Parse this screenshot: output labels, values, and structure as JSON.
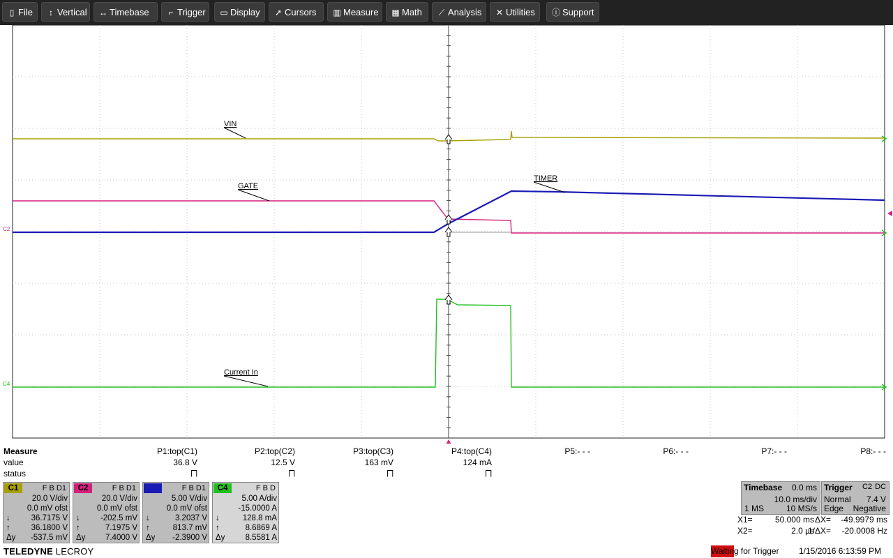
{
  "menu": [
    {
      "label": "File",
      "icon": "file-icon",
      "glyph": "▯"
    },
    {
      "label": "Vertical",
      "icon": "vertical-arrows-icon",
      "glyph": "↕"
    },
    {
      "label": "Timebase",
      "icon": "horizontal-arrows-icon",
      "glyph": "↔"
    },
    {
      "label": "Trigger",
      "icon": "trigger-icon",
      "glyph": "⌐"
    },
    {
      "label": "Display",
      "icon": "display-icon",
      "glyph": "▭"
    },
    {
      "label": "Cursors",
      "icon": "cursor-icon",
      "glyph": "➚"
    },
    {
      "label": "Measure",
      "icon": "measure-icon",
      "glyph": "▥"
    },
    {
      "label": "Math",
      "icon": "calculator-icon",
      "glyph": "▦"
    },
    {
      "label": "Analysis",
      "icon": "analysis-chart-icon",
      "glyph": "⟋"
    },
    {
      "label": "Utilities",
      "icon": "tools-icon",
      "glyph": "✕"
    },
    {
      "label": "Support",
      "icon": "info-icon",
      "glyph": "ⓘ"
    }
  ],
  "traces": {
    "vin": {
      "label": "VIN",
      "color": "#a8a000"
    },
    "gate": {
      "label": "GATE",
      "color": "#d4207c"
    },
    "timer": {
      "label": "TIMER",
      "color": "#1a1ab4"
    },
    "current": {
      "label": "Current In",
      "color": "#22c022"
    }
  },
  "markers": {
    "c2": "C2",
    "c4": "C4"
  },
  "measure": {
    "title": "Measure",
    "row_labels": [
      "value",
      "status"
    ],
    "params": [
      {
        "name": "P1:top(C1)",
        "value": "36.8 V",
        "status": "⨅"
      },
      {
        "name": "P2:top(C2)",
        "value": "12.5 V",
        "status": "⨅"
      },
      {
        "name": "P3:top(C3)",
        "value": "163 mV",
        "status": "⨅"
      },
      {
        "name": "P4:top(C4)",
        "value": "124 mA",
        "status": "⨅"
      },
      {
        "name": "P5:- - -",
        "value": "",
        "status": ""
      },
      {
        "name": "P6:- - -",
        "value": "",
        "status": ""
      },
      {
        "name": "P7:- - -",
        "value": "",
        "status": ""
      },
      {
        "name": "P8:- - -",
        "value": "",
        "status": ""
      }
    ]
  },
  "channels": [
    {
      "tag": "C1",
      "tag_color": "#a8a000",
      "tag_text": "#000000",
      "fbd": "F B D1",
      "vdiv": "20.0 V/div",
      "ofst": "0.0 mV ofst",
      "down": "36.7175 V",
      "up": "36.1800 V",
      "dy_label": "Δy",
      "dy": "-537.5 mV",
      "bg": "#bcbcbc"
    },
    {
      "tag": "C2",
      "tag_color": "#d4207c",
      "tag_text": "#000000",
      "fbd": "F B D1",
      "vdiv": "20.0 V/div",
      "ofst": "0.0 mV ofst",
      "down": "-202.5 mV",
      "up": "7.1975 V",
      "dy_label": "Δy",
      "dy": "7.4000 V",
      "bg": "#bcbcbc"
    },
    {
      "tag": "C3",
      "tag_color": "#1a1ab4",
      "tag_text": "#1a1ab4",
      "fbd": "F B D1",
      "vdiv": "5.00 V/div",
      "ofst": "0.0 mV ofst",
      "down": "3.2037 V",
      "up": "813.7 mV",
      "dy_label": "Δy",
      "dy": "-2.3900 V",
      "bg": "#bcbcbc"
    },
    {
      "tag": "C4",
      "tag_color": "#22c022",
      "tag_text": "#000000",
      "fbd": "F B D",
      "vdiv": "5.00 A/div",
      "ofst": "-15.0000 A",
      "down": "128.8 mA",
      "up": "8.6869 A",
      "dy_label": "Δy",
      "dy": "8.5581 A",
      "bg": "#d6d6d6"
    }
  ],
  "timebase": {
    "title": "Timebase",
    "delay": "0.0 ms",
    "tdiv": "10.0 ms/div",
    "samples": "1 MS",
    "rate": "10 MS/s"
  },
  "trigger": {
    "title": "Trigger",
    "source": "C2",
    "coupling": "DC",
    "mode": "Normal",
    "level": "7.4 V",
    "type": "Edge",
    "slope": "Negative"
  },
  "cursors": {
    "x1_label": "X1=",
    "x1": "50.000 ms",
    "dx_label": "ΔX=",
    "dx": "-49.9979 ms",
    "x2_label": "X2=",
    "x2": "2.0 µs",
    "inv_label": "1/ΔX=",
    "inv": "-20.0008 Hz"
  },
  "footer": {
    "brand_a": "TELEDYNE",
    "brand_b": "LECROY",
    "status": "Waiting for Trigger",
    "datetime": "1/15/2016 6:13:59 PM"
  }
}
